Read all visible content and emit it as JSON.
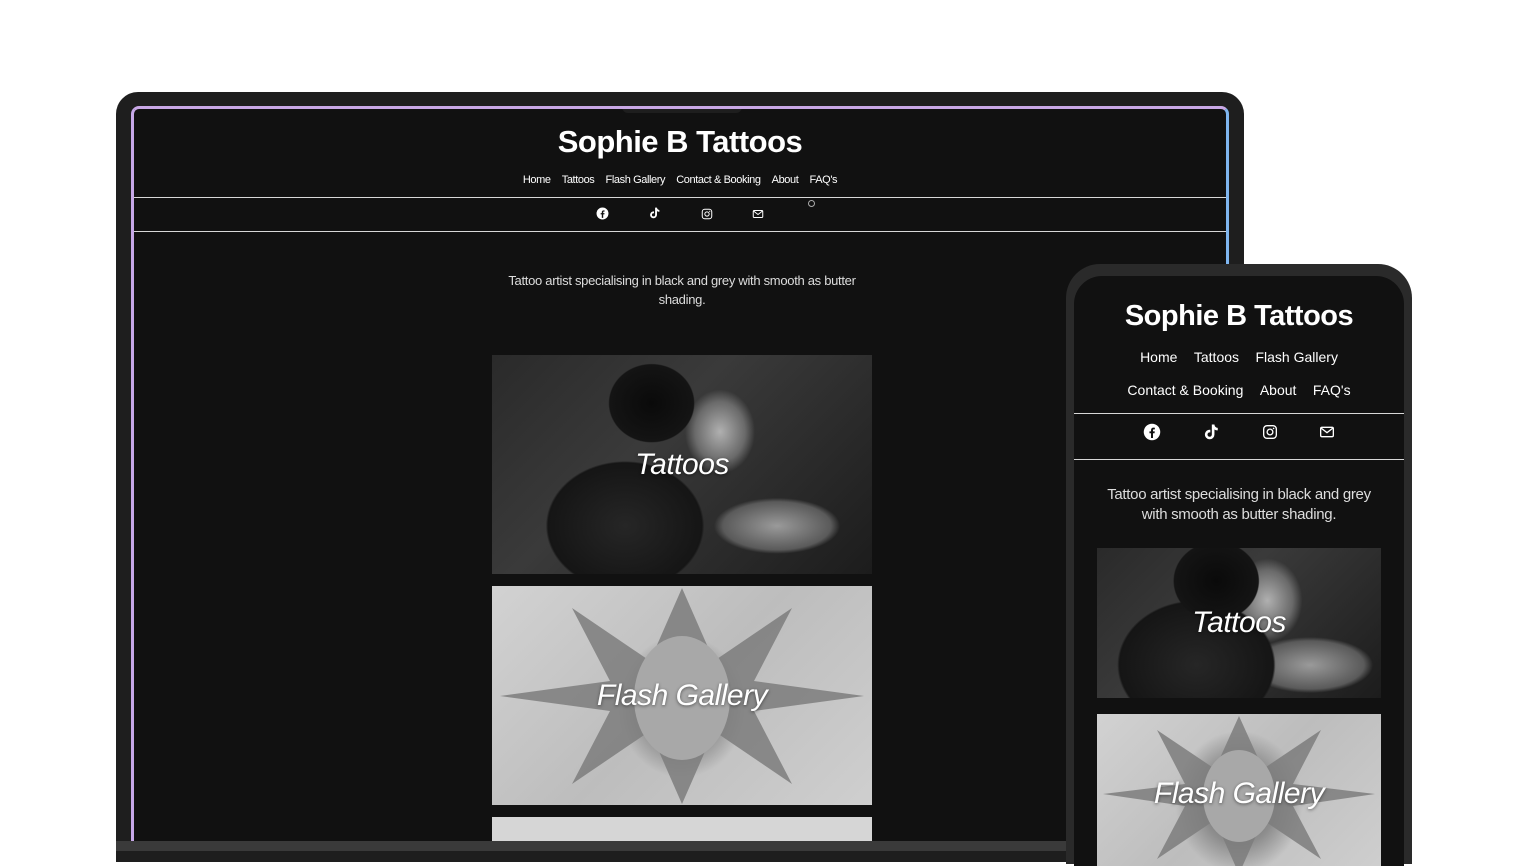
{
  "site": {
    "title": "Sophie B Tattoos",
    "nav": [
      "Home",
      "Tattoos",
      "Flash Gallery",
      "Contact & Booking",
      "About",
      "FAQ's"
    ],
    "social_icons": [
      "facebook-icon",
      "tiktok-icon",
      "instagram-icon",
      "mail-icon"
    ],
    "tagline": "Tattoo artist specialising in black and grey with smooth as butter shading.",
    "tiles": [
      {
        "label": "Tattoos"
      },
      {
        "label": "Flash Gallery"
      }
    ]
  },
  "colors": {
    "page_bg": "#111111",
    "text": "#ffffff",
    "frame_left": "#c7a8e8",
    "frame_right": "#7fb6f0"
  }
}
